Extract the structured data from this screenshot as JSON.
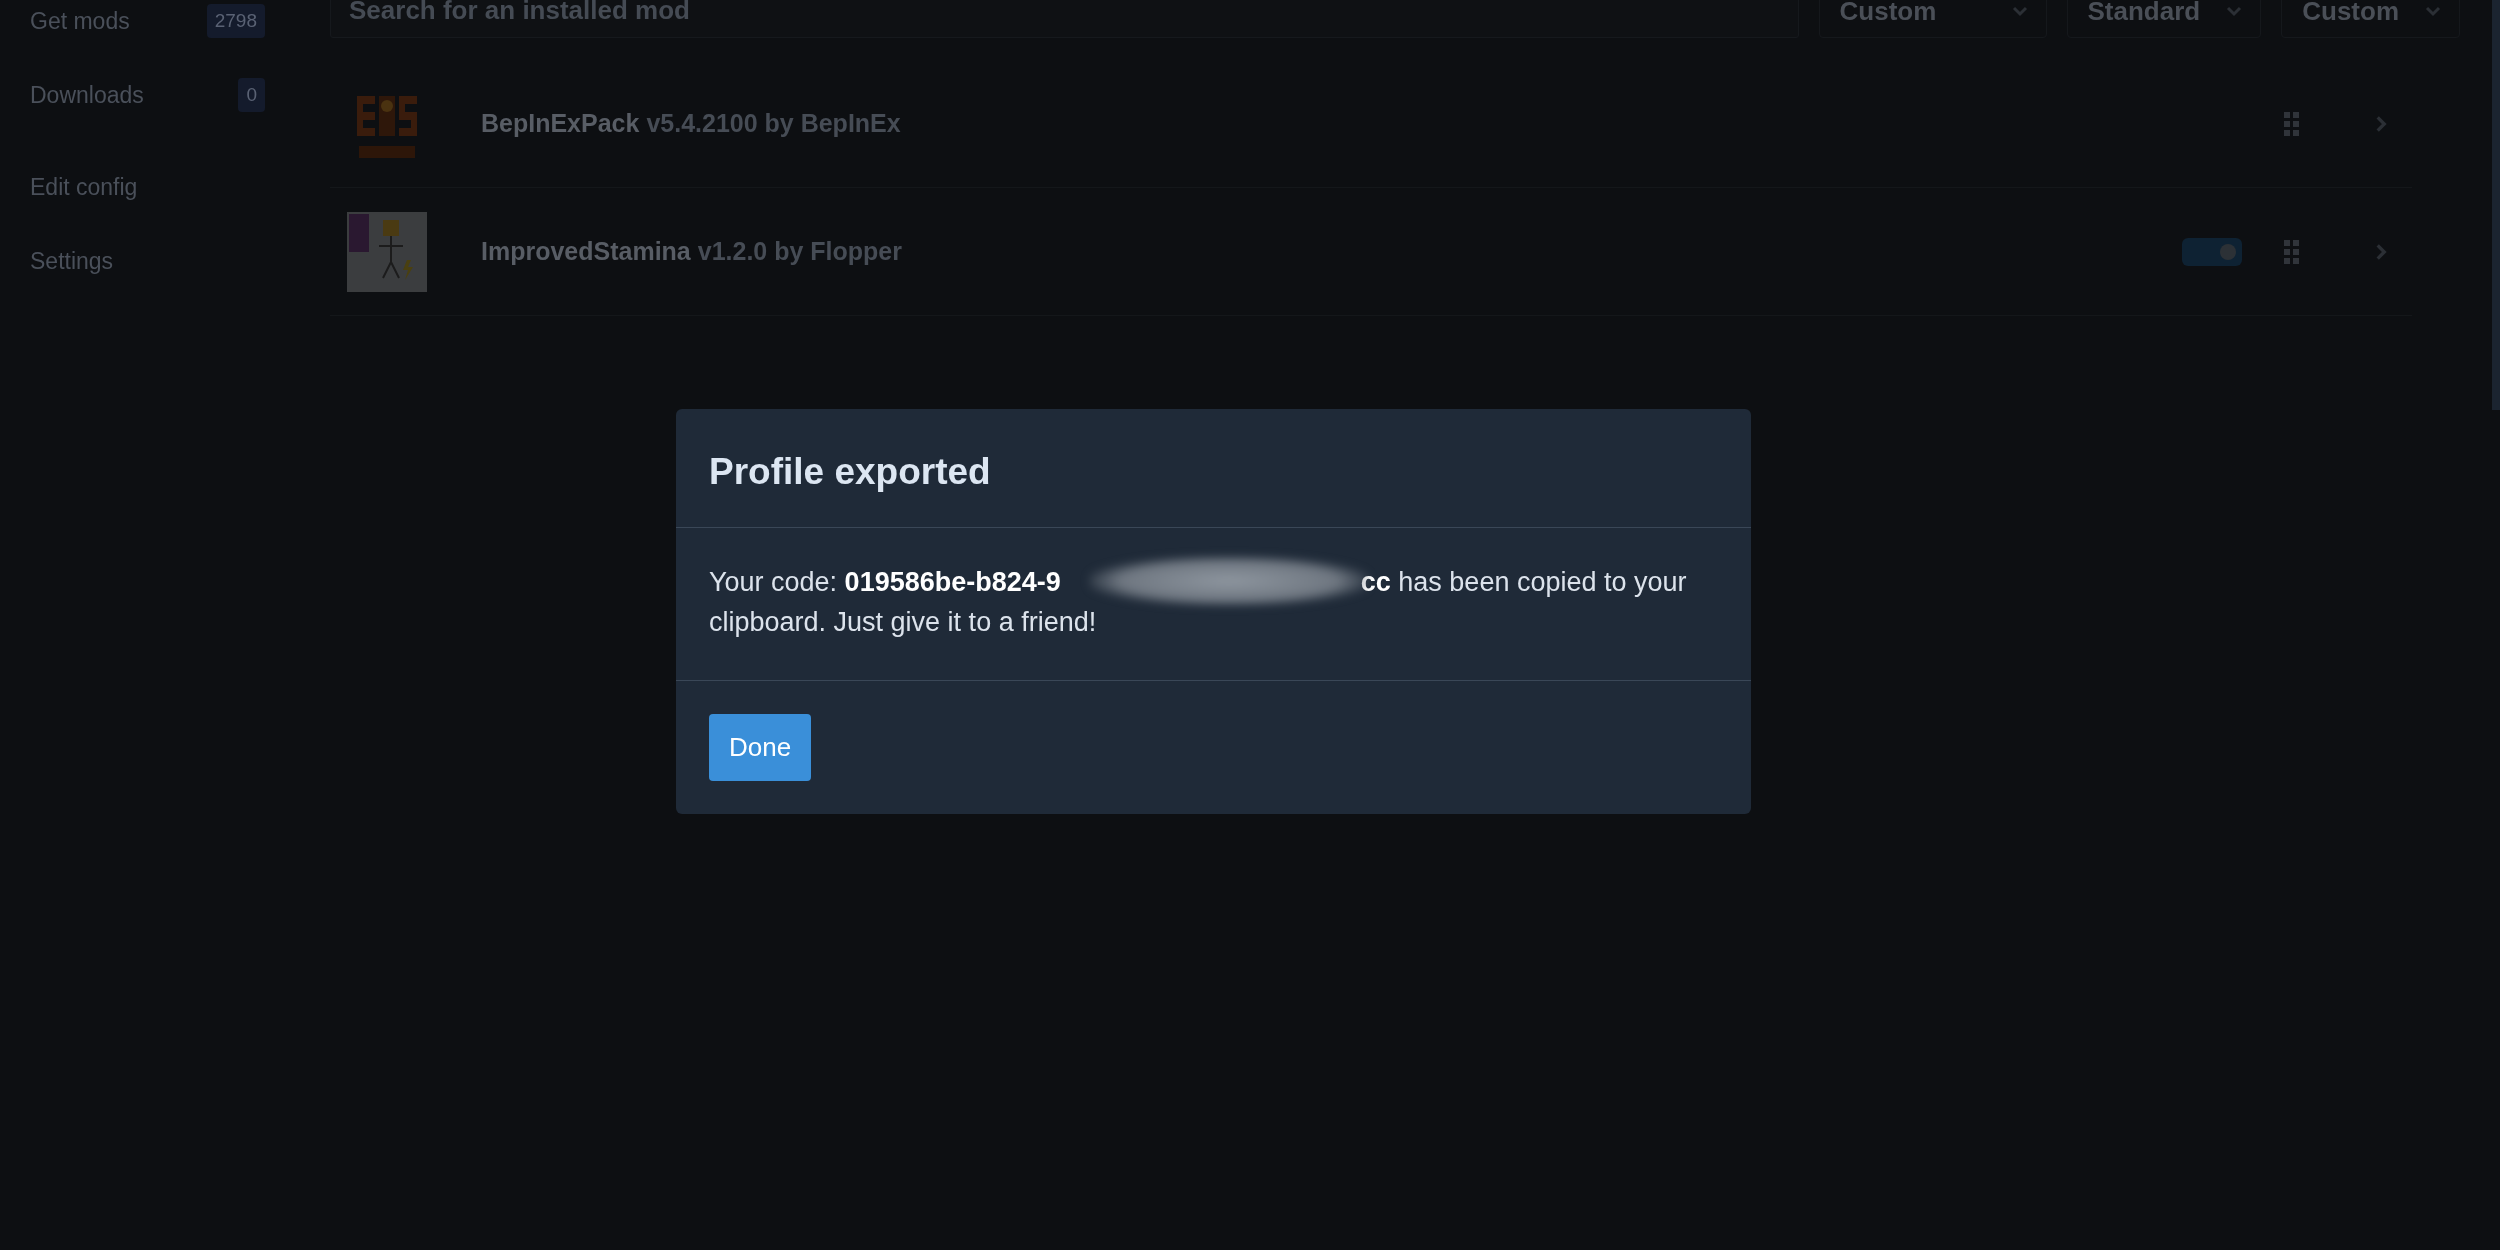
{
  "sidebar": {
    "items": [
      {
        "label": "Get mods",
        "badge": "2798",
        "selected": false
      },
      {
        "label": "Downloads",
        "badge": "0",
        "selected": false
      },
      {
        "label": "Edit config",
        "selected": false
      },
      {
        "label": "Settings",
        "selected": false
      }
    ]
  },
  "toolbar": {
    "search": {
      "placeholder": "Search for an installed mod"
    },
    "dropdowns": [
      {
        "value": "Custom"
      },
      {
        "value": "Standard"
      },
      {
        "value": "Custom"
      }
    ]
  },
  "mods": [
    {
      "name": "BepInExPack",
      "details": "v5.4.2100 by BepInEx",
      "kind": "bepinex"
    },
    {
      "name": "ImprovedStamina",
      "details": "v1.2.0 by Flopper",
      "kind": "stickman",
      "toggle": {
        "on": true
      }
    }
  ],
  "dialog": {
    "title": "Profile exported",
    "message_before": "Your code: **019586be-b824-9**",
    "message_after": "**cc** has been copied to your clipboard. Just give it to a friend!",
    "button": "Done"
  }
}
